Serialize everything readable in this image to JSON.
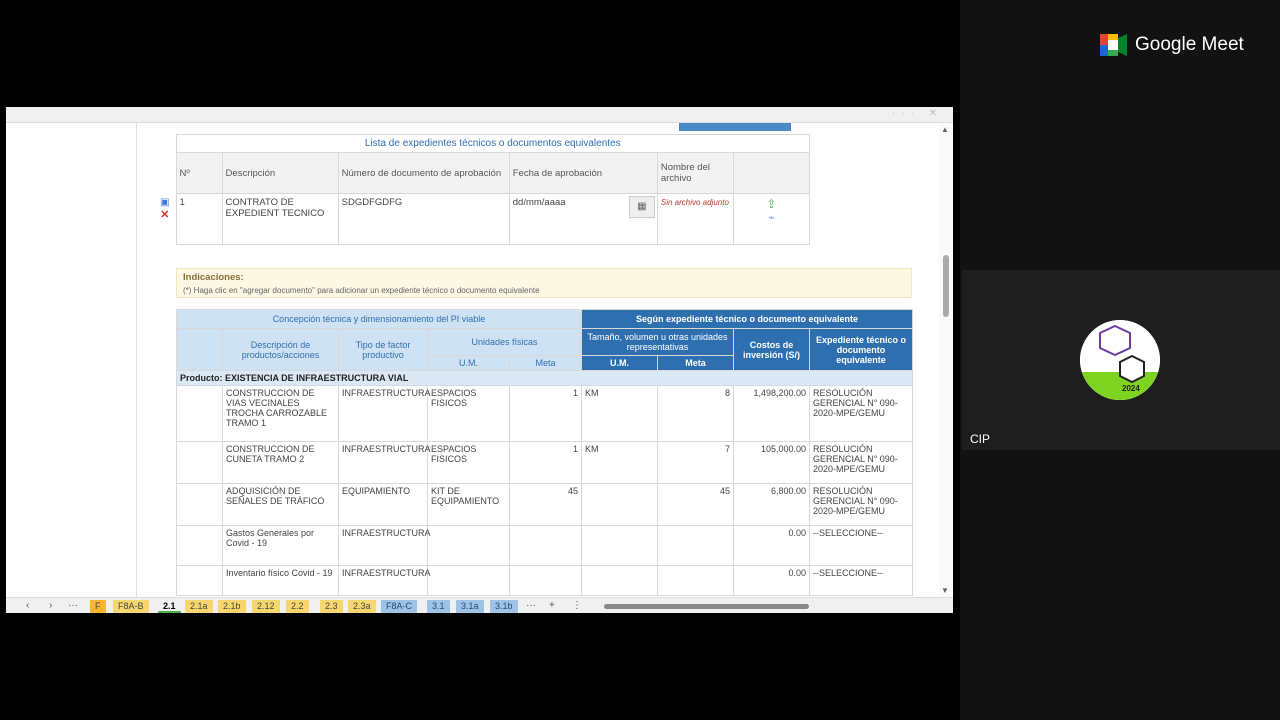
{
  "meet": {
    "brand": "Google Meet",
    "participant_name": "CIP",
    "avatar_year": "2024"
  },
  "form": {
    "list_title": "Lista de expedientes técnicos o documentos equivalentes",
    "headers": [
      "Nº",
      "Descripción",
      "Número de documento de aprobación",
      "Fecha de aprobación",
      "Nombre del archivo"
    ],
    "row": {
      "n": "1",
      "descripcion": "CONTRATO DE EXPEDIENT TECNICO",
      "numero": "SDGDFGDFG",
      "fecha_placeholder": "dd/mm/aaaa",
      "archivo": "Sin archivo adjunto"
    },
    "indic_title": "Indicaciones:",
    "indic_text": "(*)   Haga clic en \"agregar documento\" para adicionar un expediente técnico o documento equivalente"
  },
  "table": {
    "h_concepcion": "Concepción técnica y dimensionamiento del PI viable",
    "h_segun": "Según expediente técnico o documento equivalente",
    "h_desc": "Descripción de productos/acciones",
    "h_tipo": "Tipo de factor productivo",
    "h_unidades": "Unidades físicas",
    "h_um": "U.M.",
    "h_meta": "Meta",
    "h_tamano": "Tamaño, volumen u otras unidades representativas",
    "h_um2": "U.M.",
    "h_meta2": "Meta",
    "h_costos": "Costos de inversión (S/)",
    "h_expediente": "Expediente técnico o documento equivalente",
    "producto": "Producto: EXISTENCIA DE INFRAESTRUCTURA VIAL",
    "rows": [
      {
        "desc": "CONSTRUCCION DE VIAS VECINALES TROCHA CARROZABLE TRAMO 1",
        "tipo": "INFRAESTRUCTURA",
        "um": "ESPACIOS FISICOS",
        "meta": "1",
        "um2": "KM",
        "meta2": "8",
        "costo": "1,498,200.00",
        "exp": "RESOLUCIÓN GERENCIAL N° 090-2020-MPE/GEMU"
      },
      {
        "desc": "CONSTRUCCION DE CUNETA TRAMO 2",
        "tipo": "INFRAESTRUCTURA",
        "um": "ESPACIOS FISICOS",
        "meta": "1",
        "um2": "KM",
        "meta2": "7",
        "costo": "105,000.00",
        "exp": "RESOLUCIÓN GERENCIAL N° 090-2020-MPE/GEMU"
      },
      {
        "desc": "ADQUISICIÓN DE SEÑALES DE TRÁFICO",
        "tipo": "EQUIPAMIENTO",
        "um": "KIT DE EQUIPAMIENTO",
        "meta": "45",
        "um2": "",
        "meta2": "45",
        "costo": "6,800.00",
        "exp": "RESOLUCIÓN GERENCIAL N° 090-2020-MPE/GEMU"
      },
      {
        "desc": "Gastos Generales por Covid - 19",
        "tipo": "INFRAESTRUCTURA",
        "um": "",
        "meta": "",
        "um2": "",
        "meta2": "",
        "costo": "0.00",
        "exp": "--SELECCIONE--"
      },
      {
        "desc": "Inventario físico Covid - 19",
        "tipo": "INFRAESTRUCTURA",
        "um": "",
        "meta": "",
        "um2": "",
        "meta2": "",
        "costo": "0.00",
        "exp": "--SELECCIONE--"
      }
    ]
  },
  "tabs": [
    {
      "label": "F",
      "style": "o"
    },
    {
      "label": "F8A-B",
      "style": "y"
    },
    {
      "label": "2.1",
      "style": "active"
    },
    {
      "label": "2.1a",
      "style": "y"
    },
    {
      "label": "2.1b",
      "style": "y"
    },
    {
      "label": "2.12",
      "style": "y"
    },
    {
      "label": "2.2",
      "style": "y"
    },
    {
      "label": "2.3",
      "style": "y"
    },
    {
      "label": "2.3a",
      "style": "y"
    },
    {
      "label": "F8A-C",
      "style": "b"
    },
    {
      "label": "3.1",
      "style": "b"
    },
    {
      "label": "3.1a",
      "style": "b"
    },
    {
      "label": "3.1b",
      "style": "b"
    }
  ]
}
